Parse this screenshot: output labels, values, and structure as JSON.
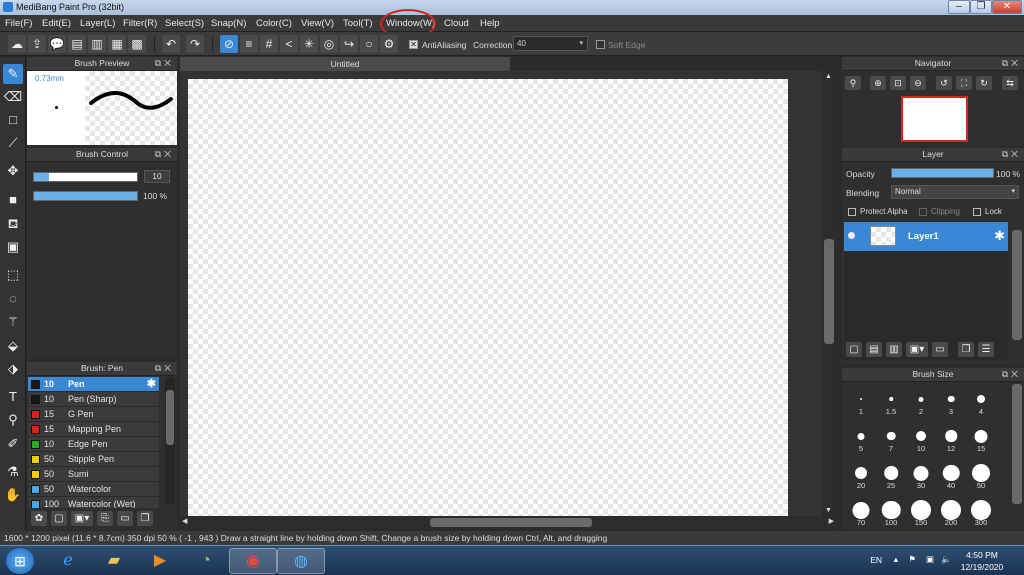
{
  "titlebar": {
    "title": "MediBang Paint Pro (32bit)",
    "minimize": "–",
    "restore": "❐",
    "close": "✕"
  },
  "menu": [
    "File(F)",
    "Edit(E)",
    "Layer(L)",
    "Filter(R)",
    "Select(S)",
    "Snap(N)",
    "Color(C)",
    "View(V)",
    "Tool(T)",
    "Window(W)",
    "Cloud",
    "Help"
  ],
  "toolbar": {
    "antialiasing_label": "AntiAliasing",
    "correction_label": "Correction",
    "correction_value": "40",
    "soft_edge_label": "Soft Edge",
    "antialiasing_checked": true,
    "soft_edge_checked": false
  },
  "brush_preview": {
    "title": "Brush Preview",
    "size_label": "0.73mm"
  },
  "brush_control": {
    "title": "Brush Control",
    "size_value": "10",
    "size_fraction": 0.15,
    "opacity_value": "100 %",
    "opacity_fraction": 1.0
  },
  "brush_list": {
    "title": "Brush: Pen",
    "items": [
      {
        "size": "10",
        "name": "Pen",
        "color": "#1a1a1a",
        "selected": true
      },
      {
        "size": "10",
        "name": "Pen (Sharp)",
        "color": "#1a1a1a"
      },
      {
        "size": "15",
        "name": "G Pen",
        "color": "#e02020"
      },
      {
        "size": "15",
        "name": "Mapping Pen",
        "color": "#e02020"
      },
      {
        "size": "10",
        "name": "Edge Pen",
        "color": "#20b020"
      },
      {
        "size": "50",
        "name": "Stipple Pen",
        "color": "#f0d000"
      },
      {
        "size": "50",
        "name": "Sumi",
        "color": "#f0d000"
      },
      {
        "size": "50",
        "name": "Watercolor",
        "color": "#4aa8e8"
      },
      {
        "size": "100",
        "name": "Watercolor (Wet)",
        "color": "#4aa8e8"
      }
    ]
  },
  "canvas": {
    "tab_title": "Untitled"
  },
  "navigator": {
    "title": "Navigator"
  },
  "layer": {
    "title": "Layer",
    "opacity_label": "Opacity",
    "opacity_value": "100 %",
    "opacity_fraction": 1.0,
    "blending_label": "Blending",
    "blending_value": "Normal",
    "protect_alpha": "Protect Alpha",
    "clipping": "Clipping",
    "lock": "Lock",
    "layers": [
      {
        "name": "Layer1",
        "selected": true
      }
    ]
  },
  "brush_size": {
    "title": "Brush Size",
    "sizes": [
      "1",
      "1.5",
      "2",
      "3",
      "4",
      "5",
      "7",
      "10",
      "12",
      "15",
      "20",
      "25",
      "30",
      "40",
      "50",
      "70",
      "100",
      "150",
      "200",
      "300"
    ]
  },
  "status": {
    "text": "1600 * 1200 pixel   (11.6 * 8.7cm)   350 dpi   50 %   ( -1 , 943 )   Draw a straight line by holding down Shift, Change a brush size by holding down Ctrl, Alt, and dragging"
  },
  "taskbar": {
    "lang": "EN",
    "time": "4:50 PM",
    "date": "12/19/2020"
  },
  "colors": {
    "accent": "#3a87d6",
    "highlight_circle": "#d62020"
  }
}
